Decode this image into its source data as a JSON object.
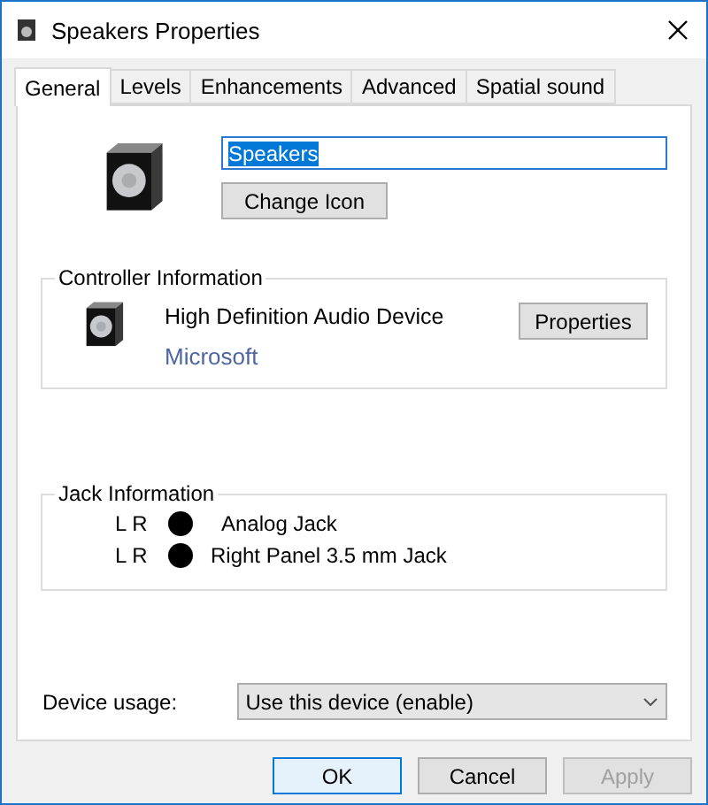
{
  "window": {
    "title": "Speakers Properties"
  },
  "tabs": [
    {
      "label": "General",
      "selected": true
    },
    {
      "label": "Levels",
      "selected": false
    },
    {
      "label": "Enhancements",
      "selected": false
    },
    {
      "label": "Advanced",
      "selected": false
    },
    {
      "label": "Spatial sound",
      "selected": false
    }
  ],
  "name_field": {
    "value": "Speakers"
  },
  "change_icon_button": "Change Icon",
  "controller": {
    "legend": "Controller Information",
    "device": "High Definition Audio Device",
    "vendor": "Microsoft",
    "button": "Properties"
  },
  "jack": {
    "legend": "Jack Information",
    "rows": [
      {
        "channels": "L R",
        "name": "Analog Jack"
      },
      {
        "channels": "L R",
        "name": "Right Panel 3.5 mm Jack"
      }
    ]
  },
  "device_usage": {
    "label": "Device usage:",
    "value": "Use this device (enable)"
  },
  "buttons": [
    {
      "label": "OK",
      "disabled": false,
      "focused": true
    },
    {
      "label": "Cancel",
      "disabled": false,
      "focused": false
    },
    {
      "label": "Apply",
      "disabled": true,
      "focused": false
    }
  ]
}
